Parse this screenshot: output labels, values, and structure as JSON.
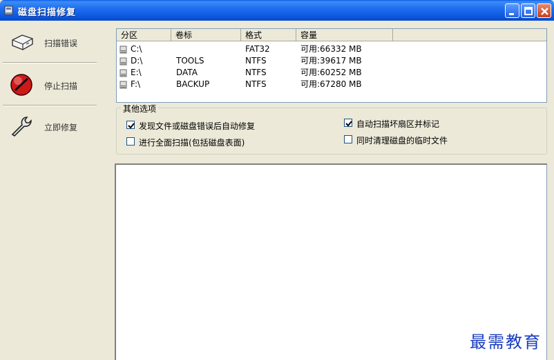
{
  "window": {
    "title": "磁盘扫描修复"
  },
  "sidebar": {
    "items": [
      {
        "label": "扫描错误",
        "icon": "disk-icon"
      },
      {
        "label": "停止扫描",
        "icon": "stop-icon"
      },
      {
        "label": "立即修复",
        "icon": "wrench-icon"
      }
    ]
  },
  "drive_list": {
    "columns": [
      "分区",
      "卷标",
      "格式",
      "容量"
    ],
    "rows": [
      {
        "partition": "C:\\",
        "label": "",
        "format": "FAT32",
        "capacity": "可用:66332 MB"
      },
      {
        "partition": "D:\\",
        "label": "TOOLS",
        "format": "NTFS",
        "capacity": "可用:39617 MB"
      },
      {
        "partition": "E:\\",
        "label": "DATA",
        "format": "NTFS",
        "capacity": "可用:60252 MB"
      },
      {
        "partition": "F:\\",
        "label": "BACKUP",
        "format": "NTFS",
        "capacity": "可用:67280 MB"
      }
    ]
  },
  "options": {
    "legend": "其他选项",
    "items": [
      {
        "label": "发现文件或磁盘错误后自动修复",
        "checked": true
      },
      {
        "label": "进行全面扫描(包括磁盘表面)",
        "checked": false
      },
      {
        "label": "自动扫描坏扇区并标记",
        "checked": true
      },
      {
        "label": "同时清理磁盘的临时文件",
        "checked": false
      }
    ]
  },
  "watermark": "最需教育",
  "colors": {
    "titlebar": "#0a55dd",
    "window_bg": "#ece9d8",
    "watermark": "#1a3cbf"
  }
}
